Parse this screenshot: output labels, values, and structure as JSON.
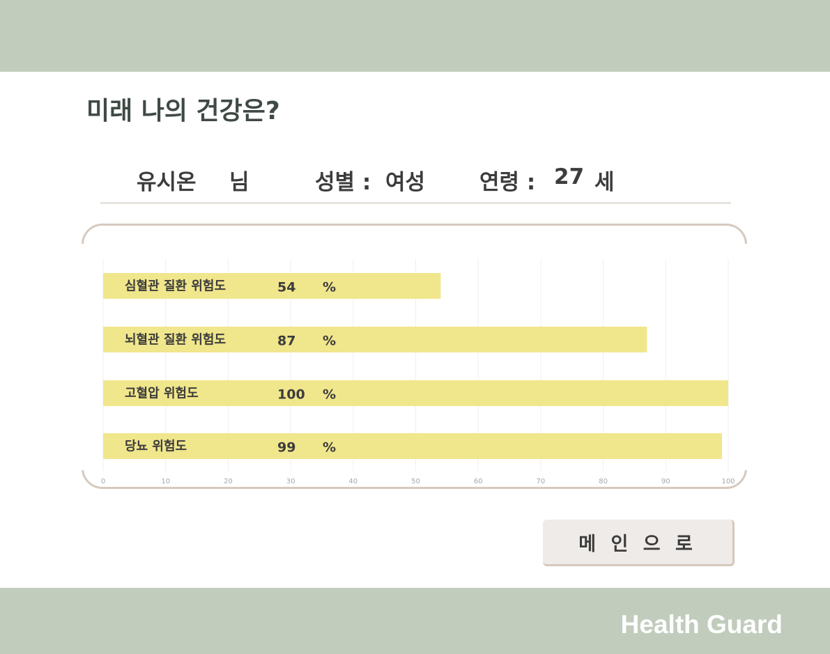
{
  "page": {
    "title": "미래 나의 건강은?"
  },
  "user": {
    "name": "유시온",
    "honorific": "님",
    "gender_label": "성별 :",
    "gender_value": "여성",
    "age_label": "연령 :",
    "age_value": "27",
    "age_unit": "세"
  },
  "colors": {
    "header_bg": "#c1ccbd",
    "bar": "#f0e68c",
    "card_border": "#d7c9bd",
    "button_bg": "#efebe8"
  },
  "chart_data": {
    "type": "bar",
    "orientation": "horizontal",
    "categories": [
      "심혈관 질환 위험도",
      "뇌혈관 질환 위험도",
      "고혈압 위험도",
      "당뇨 위험도"
    ],
    "values": [
      54,
      87,
      100,
      99
    ],
    "value_unit": "%",
    "xlim": [
      0,
      100
    ],
    "xticks": [
      0,
      10,
      20,
      30,
      40,
      50,
      60,
      70,
      80,
      90,
      100
    ],
    "grid": true,
    "title": "",
    "xlabel": "",
    "ylabel": ""
  },
  "actions": {
    "main_button": "메 인 으 로"
  },
  "footer": {
    "brand": "Health Guard"
  }
}
